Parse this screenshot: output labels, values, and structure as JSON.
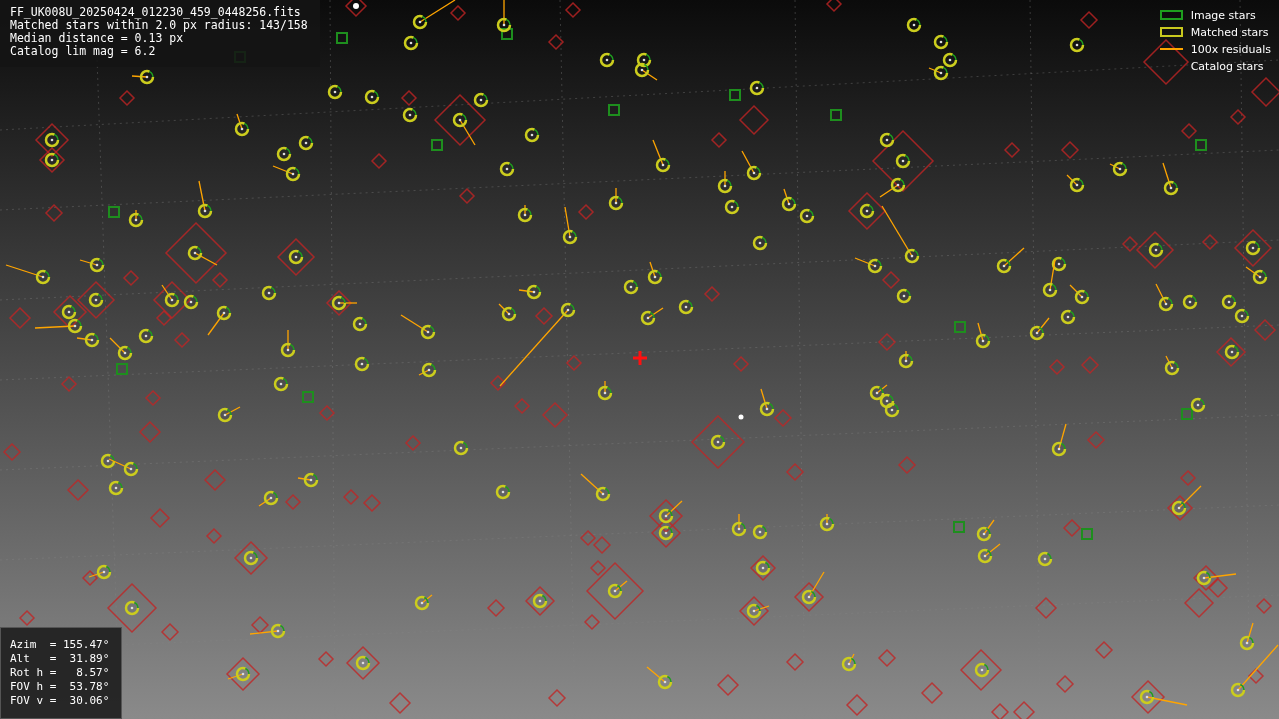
{
  "info_box": {
    "lines": [
      "FF_UK008U_20250424_012230_459_0448256.fits",
      "Matched stars within 2.0 px radius: 143/158",
      "Median distance = 0.13 px",
      "Catalog lim mag = 6.2"
    ]
  },
  "legend": [
    {
      "kind": "image",
      "label": "Image stars"
    },
    {
      "kind": "matched",
      "label": "Matched stars"
    },
    {
      "kind": "residual",
      "label": "100x residuals"
    },
    {
      "kind": "catalog",
      "label": "Catalog stars"
    }
  ],
  "pointing_box": {
    "lines": [
      "Azim  = 155.47°",
      "Alt   =  31.89°",
      "Rot h =   8.57°",
      "FOV h =  53.78°",
      "FOV v =  30.06°"
    ]
  }
}
